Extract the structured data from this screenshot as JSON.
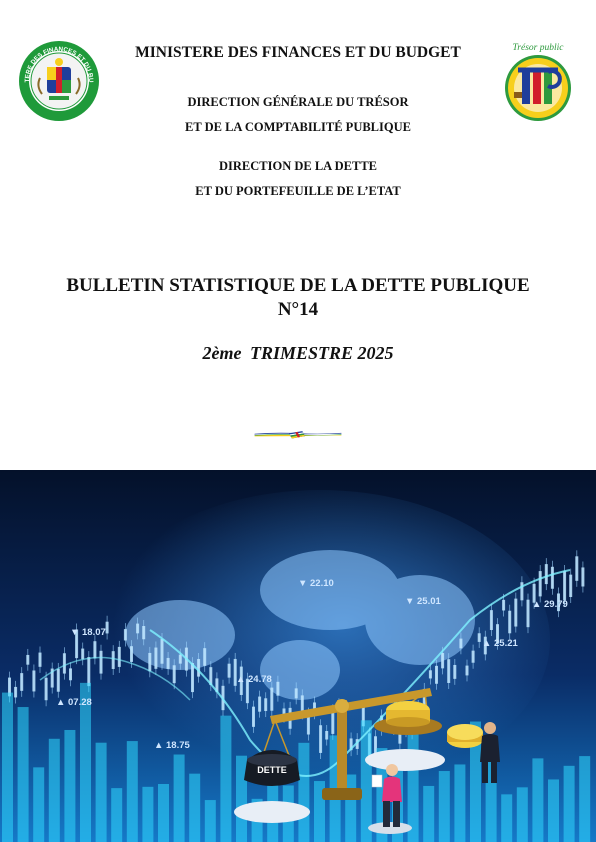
{
  "header": {
    "ministry": "MINISTERE DES FINANCES ET DU BUDGET",
    "direction_generale": [
      "DIRECTION GÉNÉRALE DU TRÉSOR",
      "ET DE LA COMPTABILITÉ PUBLIQUE"
    ],
    "direction": [
      "DIRECTION DE LA DETTE",
      "ET DU PORTEFEUILLE DE L’ETAT"
    ],
    "left_seal_text": "MINISTERE DES FINANCES ET DU BUDGET",
    "right_logo_text": "Trésor public"
  },
  "bulletin": {
    "title_line1": "BULLETIN STATISTIQUE DE LA DETTE PUBLIQUE",
    "title_line2": "N°14",
    "period_ordinal": "2ème",
    "period_label": "TRIMESTRE 2025"
  },
  "illustration": {
    "chart_labels": [
      {
        "dir": "down",
        "text": "22.10"
      },
      {
        "dir": "down",
        "text": "25.01"
      },
      {
        "dir": "up",
        "text": "29.79"
      },
      {
        "dir": "down",
        "text": "18.07"
      },
      {
        "dir": "up",
        "text": "25.21"
      },
      {
        "dir": "up",
        "text": "24.78"
      },
      {
        "dir": "up",
        "text": "07.28"
      },
      {
        "dir": "up",
        "text": "18.75"
      }
    ],
    "weight_label": "DETTE"
  },
  "colors": {
    "flag_blue": "#1f3e9b",
    "flag_green": "#2e9a3e",
    "flag_yellow": "#f7cf1c",
    "flag_red": "#d21f2b",
    "cover_dark": "#061a3a",
    "cover_glow": "#25d7ff"
  }
}
